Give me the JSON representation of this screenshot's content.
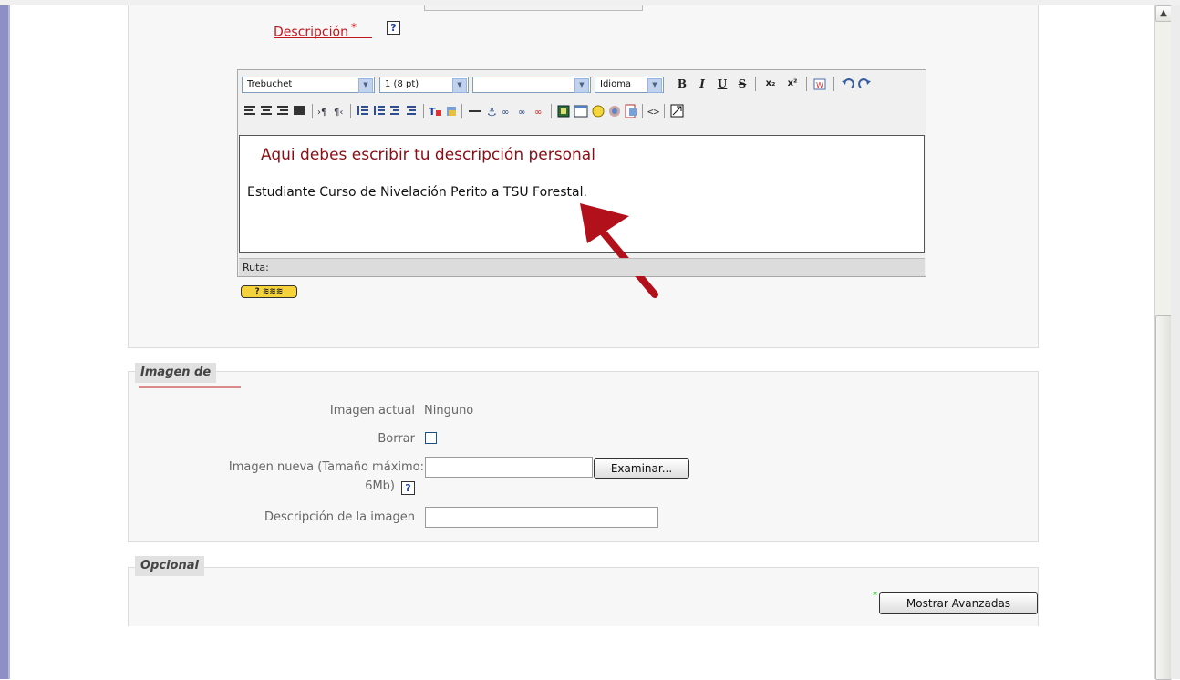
{
  "description_section": {
    "label": "Descripción",
    "required_mark": "*",
    "help": "?",
    "editor": {
      "font_family": "Trebuchet",
      "font_size": "1 (8 pt)",
      "style": "",
      "language": "Idioma",
      "bold": "B",
      "italic": "I",
      "underline": "U",
      "strike": "S",
      "subscript": "x₂",
      "superscript": "x²",
      "annotation_heading": "Aqui debes escribir tu descripción personal",
      "content": "Estudiante Curso de Nivelación Perito a TSU Forestal.",
      "path_label": "Ruta:",
      "help_badge": "? ≋≋≋"
    }
  },
  "image_section": {
    "legend": "Imagen de",
    "current_image_label": "Imagen actual",
    "current_image_value": "Ninguno",
    "delete_label": "Borrar",
    "new_image_label_1": "Imagen nueva (Tamaño máximo:",
    "new_image_label_2": "6Mb)",
    "browse_button": "Examinar...",
    "image_description_label": "Descripción de la imagen",
    "help": "?"
  },
  "optional_section": {
    "legend": "Opcional",
    "show_advanced_button": "Mostrar Avanzadas",
    "marker": "*"
  },
  "scrollbar": {
    "up_arrow": "▲"
  },
  "colors": {
    "accent_red": "#c3161c",
    "annotation_dark_red": "#8b0e14",
    "legend_underline": "#d98a8a",
    "page_border": "#8e8fc4"
  }
}
